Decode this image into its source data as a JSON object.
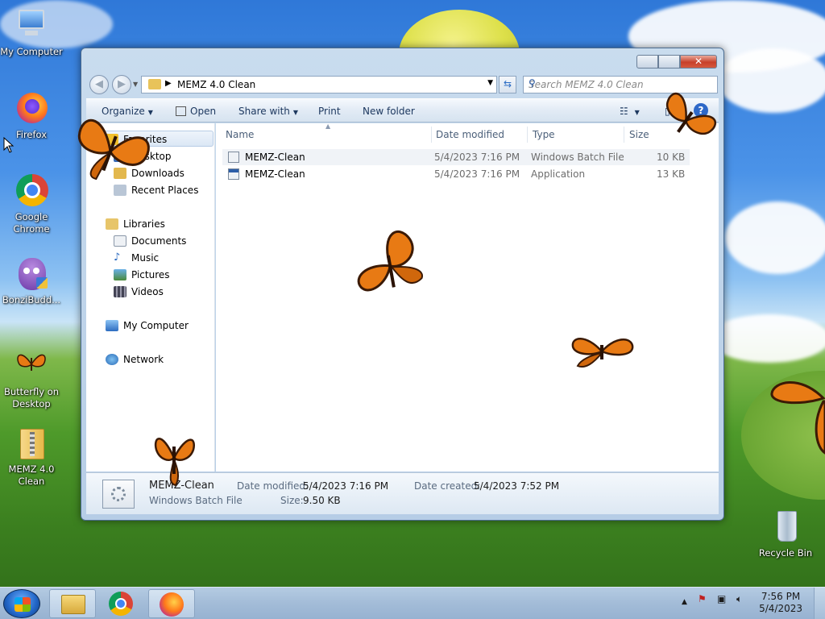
{
  "desktop": {
    "icons": [
      {
        "label": "My Computer"
      },
      {
        "label": "Firefox"
      },
      {
        "label": "Google Chrome"
      },
      {
        "label": "BonziBudd..."
      },
      {
        "label": "Butterfly on Desktop"
      },
      {
        "label": "MEMZ 4.0 Clean"
      },
      {
        "label": "Recycle Bin"
      }
    ]
  },
  "window": {
    "address_path": "MEMZ 4.0 Clean",
    "search_placeholder": "Search MEMZ 4.0 Clean",
    "toolbar": {
      "organize": "Organize",
      "open": "Open",
      "share_with": "Share with",
      "print": "Print",
      "new_folder": "New folder"
    },
    "nav": {
      "favorites": "Favorites",
      "desktop": "Desktop",
      "downloads": "Downloads",
      "recent_places": "Recent Places",
      "libraries": "Libraries",
      "documents": "Documents",
      "music": "Music",
      "pictures": "Pictures",
      "videos": "Videos",
      "my_computer": "My Computer",
      "network": "Network"
    },
    "columns": {
      "name": "Name",
      "date_modified": "Date modified",
      "type": "Type",
      "size": "Size"
    },
    "files": [
      {
        "name": "MEMZ-Clean",
        "date": "5/4/2023 7:16 PM",
        "type": "Windows Batch File",
        "size": "10 KB"
      },
      {
        "name": "MEMZ-Clean",
        "date": "5/4/2023 7:16 PM",
        "type": "Application",
        "size": "13 KB"
      }
    ],
    "details": {
      "name": "MEMZ-Clean",
      "kind": "Windows Batch File",
      "date_modified_label": "Date modified:",
      "date_modified": "5/4/2023 7:16 PM",
      "date_created_label": "Date created:",
      "date_created": "5/4/2023 7:52 PM",
      "size_label": "Size:",
      "size": "9.50 KB"
    }
  },
  "taskbar": {
    "clock_time": "7:56 PM",
    "clock_date": "5/4/2023"
  },
  "colors": {
    "butterfly_orange": "#e87a14",
    "butterfly_dark": "#3b1a06"
  }
}
